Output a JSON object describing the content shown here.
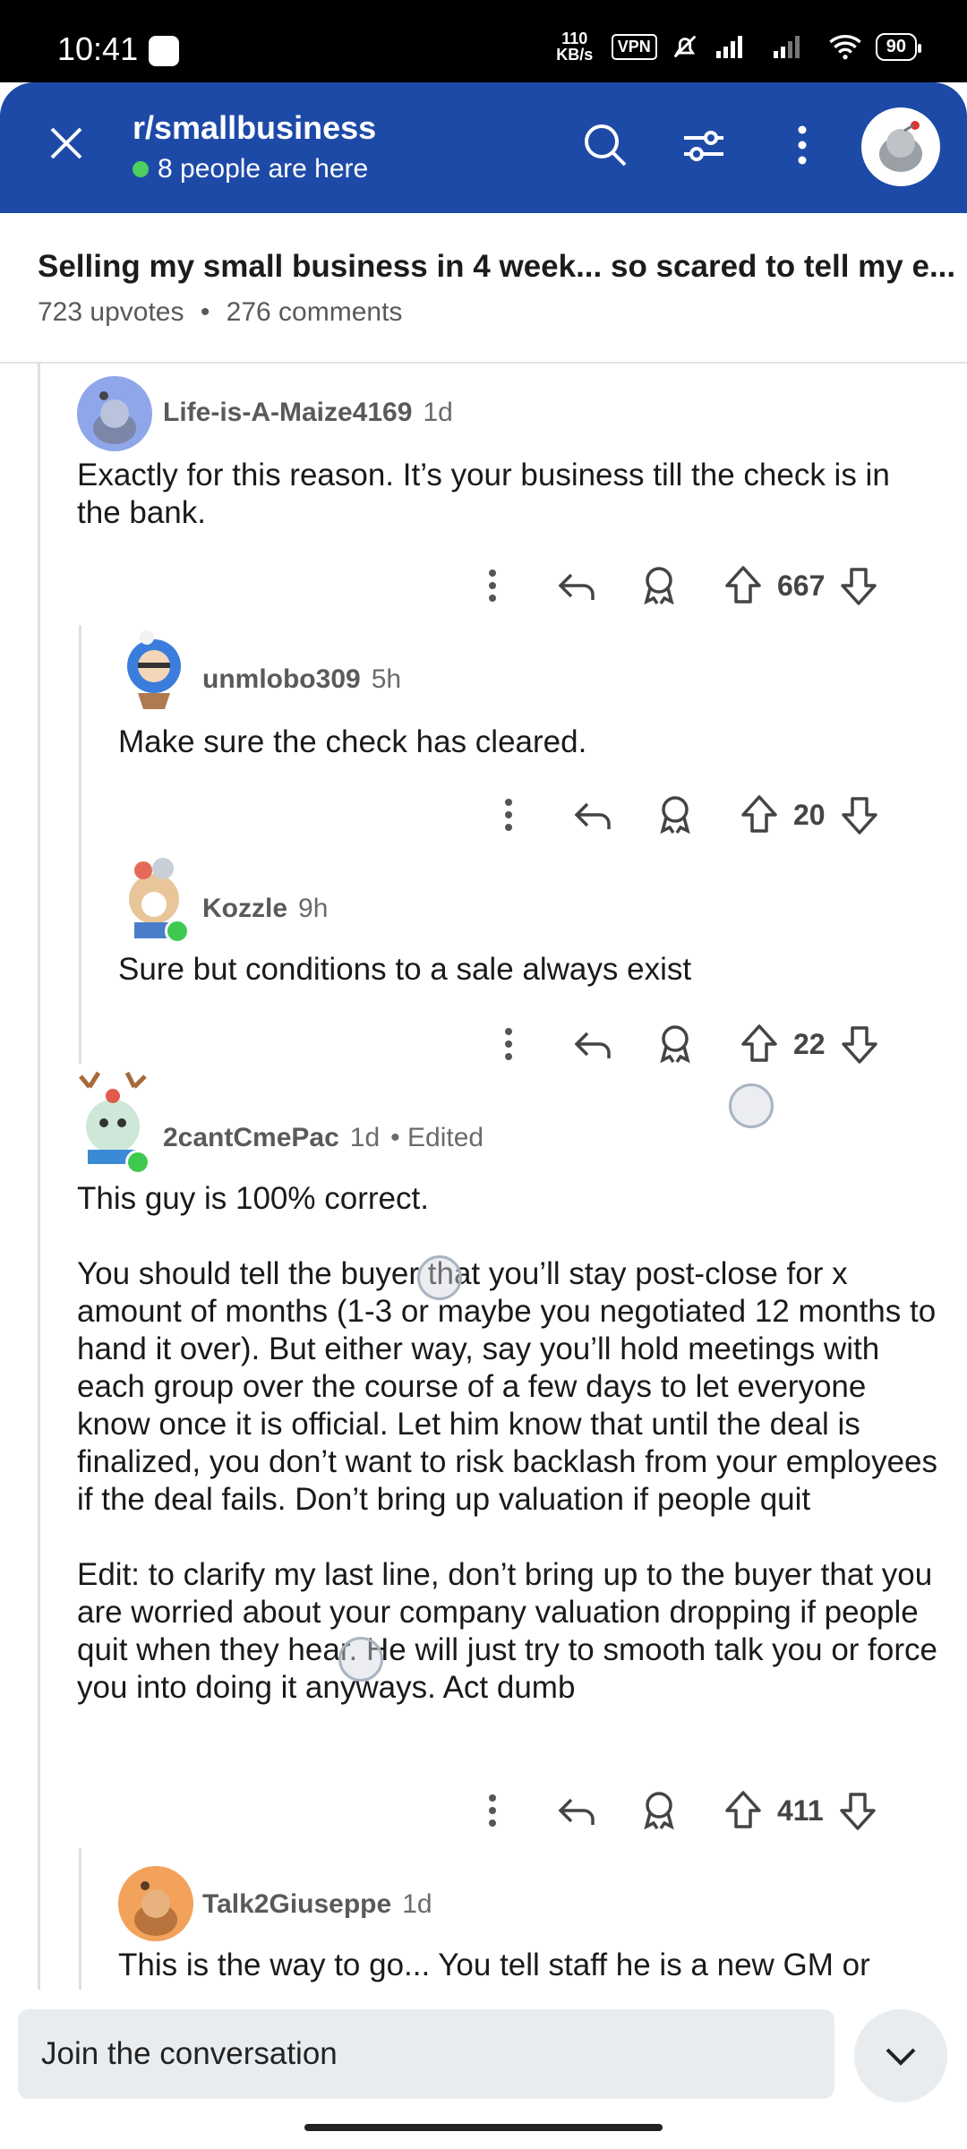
{
  "status_bar": {
    "time": "10:41",
    "speed": "110 KB/s",
    "vpn": "VPN",
    "battery": "90"
  },
  "header": {
    "subreddit": "r/smallbusiness",
    "online": "8 people are here"
  },
  "post": {
    "title": "Selling my small business in 4 week... so scared to tell my e...",
    "upvotes": "723 upvotes",
    "comments": "276 comments",
    "separator": "•"
  },
  "comments": [
    {
      "user": "Life-is-A-Maize4169",
      "time": "1d",
      "body": "Exactly for this reason. It’s your business till the check is in the bank.",
      "votes": "667"
    },
    {
      "user": "unmlobo309",
      "time": "5h",
      "body": "Make sure the check has cleared.",
      "votes": "20"
    },
    {
      "user": "Kozzle",
      "time": "9h",
      "body": "Sure but conditions to a sale always exist",
      "votes": "22"
    },
    {
      "user": "2cantCmePac",
      "time": "1d",
      "edited": "• Edited",
      "body": "This guy is 100% correct.\n\nYou should tell the buyer that you’ll stay post-close for x amount of months (1-3 or maybe you negotiated 12 months to hand it over). But either way, say you’ll hold meetings with each group over the course of a few days to let everyone know once it is official. Let him know that until the deal is finalized, you don’t want to risk backlash from your employees if the deal fails. Don’t bring up valuation if people quit\n\nEdit: to clarify my last line, don’t bring up to the buyer that you are worried about your company valuation dropping if people quit when they hear. He will just try to smooth talk you or force you into doing it anyways. Act dumb",
      "votes": "411"
    },
    {
      "user": "Talk2Giuseppe",
      "time": "1d",
      "body": "This is the way to go... You tell staff he is a new GM or"
    }
  ],
  "bottom": {
    "placeholder": "Join the conversation"
  },
  "colors": {
    "header": "#1e4aa7",
    "online_dot": "#4ccf5f"
  }
}
